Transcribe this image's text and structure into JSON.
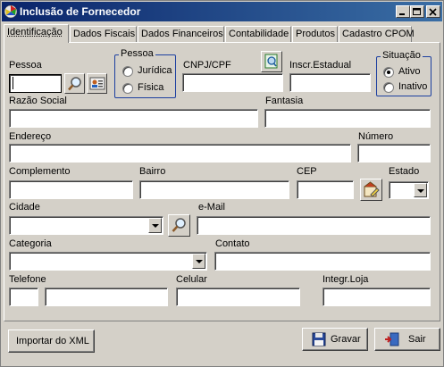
{
  "window": {
    "title": "Inclusão de Fornecedor"
  },
  "tabs": [
    {
      "label": "Identificação"
    },
    {
      "label": "Dados Fiscais"
    },
    {
      "label": "Dados Financeiros"
    },
    {
      "label": "Contabilidade"
    },
    {
      "label": "Produtos"
    },
    {
      "label": "Cadastro CPOM"
    }
  ],
  "form": {
    "pessoa_label": "Pessoa",
    "pessoa_value": "",
    "tipo_pessoa": {
      "label": "Pessoa",
      "options": [
        "Jurídica",
        "Física"
      ],
      "selected": null
    },
    "cnpj_label": "CNPJ/CPF",
    "inscr_label": "Inscr.Estadual",
    "situacao": {
      "label": "Situação",
      "options": [
        "Ativo",
        "Inativo"
      ],
      "selected": "Ativo"
    },
    "razao_label": "Razão Social",
    "fantasia_label": "Fantasia",
    "endereco_label": "Endereço",
    "numero_label": "Número",
    "complemento_label": "Complemento",
    "bairro_label": "Bairro",
    "cep_label": "CEP",
    "estado_label": "Estado",
    "cidade_label": "Cidade",
    "email_label": "e-Mail",
    "categoria_label": "Categoria",
    "contato_label": "Contato",
    "telefone_label": "Telefone",
    "celular_label": "Celular",
    "integr_label": "Integr.Loja"
  },
  "footer": {
    "importar_label": "Importar do XML",
    "gravar_label": "Gravar",
    "sair_label": "Sair"
  }
}
